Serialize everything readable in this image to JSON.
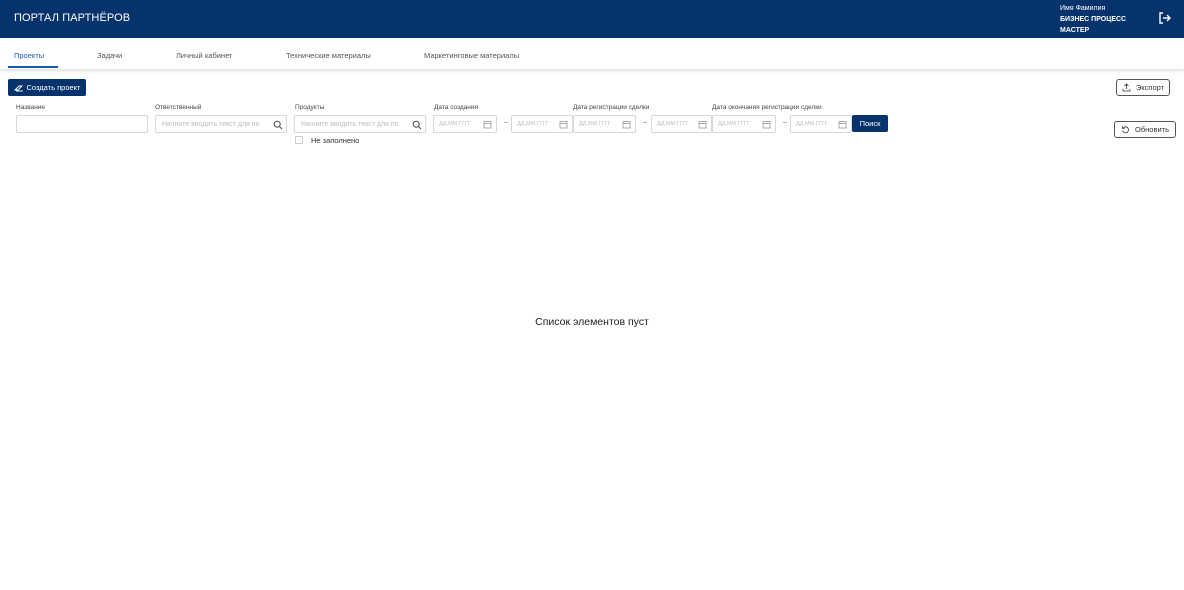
{
  "header": {
    "brand": "ПОРТАЛ ПАРТНЁРОВ",
    "user_name": "Имя Фамилия",
    "user_role_line1": "БИЗНЕС ПРОЦЕСС",
    "user_role_line2": "МАСТЕР",
    "logout_icon": "logout-icon"
  },
  "tabs": [
    {
      "label": "Проекты",
      "active": true
    },
    {
      "label": "Задачи",
      "active": false
    },
    {
      "label": "Личный кабинет",
      "active": false
    },
    {
      "label": "Технические материалы",
      "active": false
    },
    {
      "label": "Маркетинговые материалы",
      "active": false
    }
  ],
  "toolbar": {
    "create_label": "Создать проект",
    "export_label": "Экспорт",
    "refresh_label": "Обновить",
    "search_label": "Поиск"
  },
  "filters": {
    "name_label": "Название",
    "responsible_label": "Ответственный",
    "responsible_placeholder": "Начните вводить текст для по",
    "products_label": "Продукты",
    "products_placeholder": "Начните вводить текст для по",
    "created_label": "Дата создания",
    "reg_label": "Дата регистрации сделки",
    "reg_end_label": "Дата окончания регистрации сделки",
    "date_placeholder": "ДД.ММ.ГГГГ",
    "range_sep": "–",
    "unfilled_label": "Не заполнено"
  },
  "main": {
    "empty_text": "Список элементов пуст"
  },
  "colors": {
    "brand": "#06336b",
    "accent": "#1a5ba8"
  }
}
